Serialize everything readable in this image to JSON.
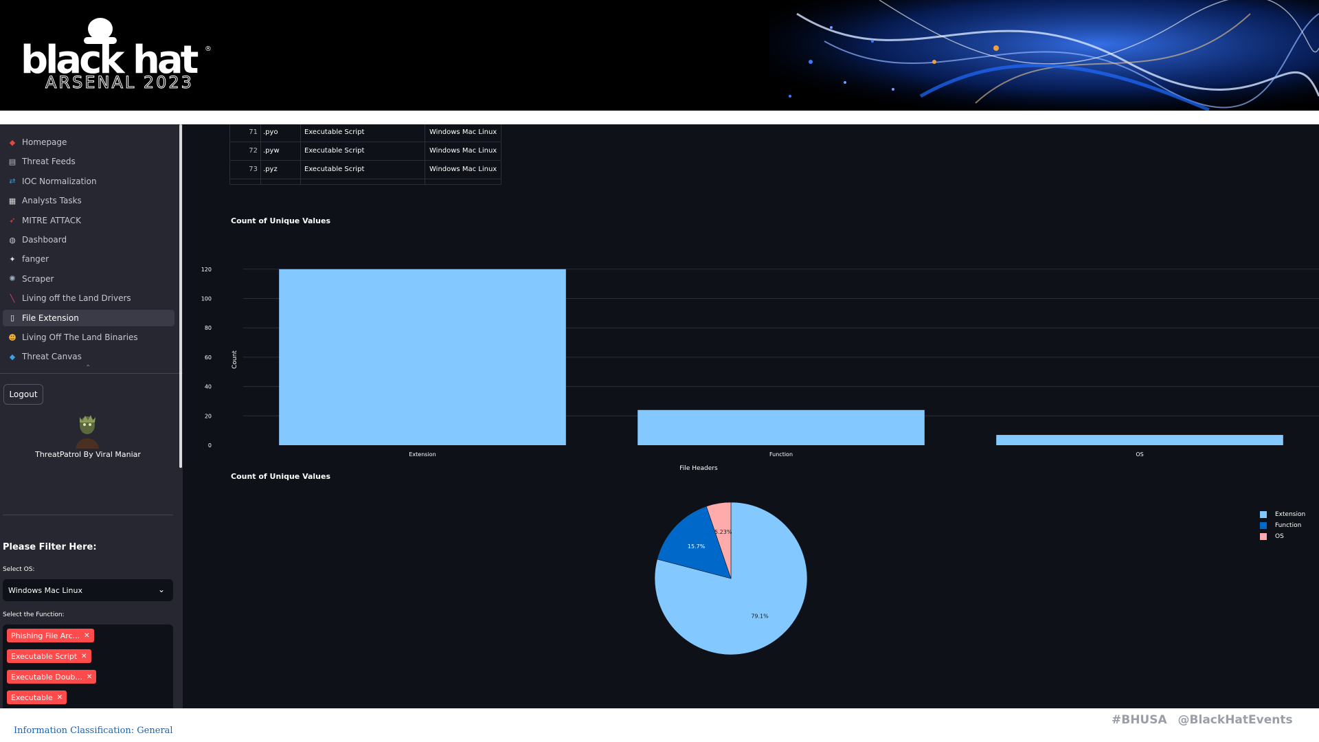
{
  "banner": {
    "logo_wordmark": "black hat",
    "logo_reg": "®",
    "logo_sub": "ARSENAL 2023"
  },
  "sidebar": {
    "items": [
      {
        "label": "Homepage",
        "icon": "map-icon",
        "color": "#e8453c"
      },
      {
        "label": "Threat Feeds",
        "icon": "newspaper-icon",
        "color": "#b7bcc6"
      },
      {
        "label": "IOC Normalization",
        "icon": "arrows-icon",
        "color": "#2f9ae0"
      },
      {
        "label": "Analysts Tasks",
        "icon": "clipboard-icon",
        "color": "#d8d8d8"
      },
      {
        "label": "MITRE ATTACK",
        "icon": "rocket-icon",
        "color": "#e8453c"
      },
      {
        "label": "Dashboard",
        "icon": "gauge-icon",
        "color": "#c8c8c8"
      },
      {
        "label": "fanger",
        "icon": "person-icon",
        "color": "#e0e0e0"
      },
      {
        "label": "Scraper",
        "icon": "atom-icon",
        "color": "#9ab0c4"
      },
      {
        "label": "Living off the Land Drivers",
        "icon": "screwdriver-icon",
        "color": "#e0447a"
      },
      {
        "label": "File Extension",
        "icon": "page-icon",
        "color": "#f0f0f0"
      },
      {
        "label": "Living Off The Land Binaries",
        "icon": "cool-face-icon",
        "color": "#f5b335"
      },
      {
        "label": "Threat Canvas",
        "icon": "diamond-icon",
        "color": "#3aa0e8"
      }
    ],
    "active_index": 9,
    "more_glyph": "⌃",
    "logout_label": "Logout",
    "credit": "ThreatPatrol By Viral Maniar",
    "filter_title": "Please Filter Here:",
    "os_label": "Select OS:",
    "os_value": "Windows Mac Linux",
    "fn_label": "Select the Function:",
    "fn_tags": [
      "Phishing File Arc...",
      "Executable Script",
      "Executable Doub...",
      "Executable"
    ]
  },
  "table": {
    "rows": [
      {
        "idx": "71",
        "ext": ".pyo",
        "fn": "Executable Script",
        "os": "Windows Mac Linux"
      },
      {
        "idx": "72",
        "ext": ".pyw",
        "fn": "Executable Script",
        "os": "Windows Mac Linux"
      },
      {
        "idx": "73",
        "ext": ".pyz",
        "fn": "Executable Script",
        "os": "Windows Mac Linux"
      }
    ]
  },
  "charts": {
    "bar_title": "Count of Unique Values",
    "pie_title": "Count of Unique Values"
  },
  "chart_data": [
    {
      "type": "bar",
      "title": "Count of Unique Values",
      "categories": [
        "Extension",
        "Function",
        "OS"
      ],
      "values": [
        120,
        24,
        7
      ],
      "xlabel": "File Headers",
      "ylabel": "Count",
      "yticks": [
        0,
        20,
        40,
        60,
        80,
        100,
        120
      ],
      "ylim": [
        0,
        126
      ],
      "color": "#83c9ff",
      "grid": true
    },
    {
      "type": "pie",
      "title": "Count of Unique Values",
      "labels": [
        "Extension",
        "Function",
        "OS"
      ],
      "values": [
        79.1,
        15.7,
        5.23
      ],
      "value_labels": [
        "79.1%",
        "15.7%",
        "5.23%"
      ],
      "colors": [
        "#83c9ff",
        "#0068c9",
        "#ffabab"
      ],
      "legend": "top-right"
    }
  ],
  "footer": {
    "classification": "Information Classification: General",
    "hashtags": "#BHUSA @BlackHatEvents"
  }
}
